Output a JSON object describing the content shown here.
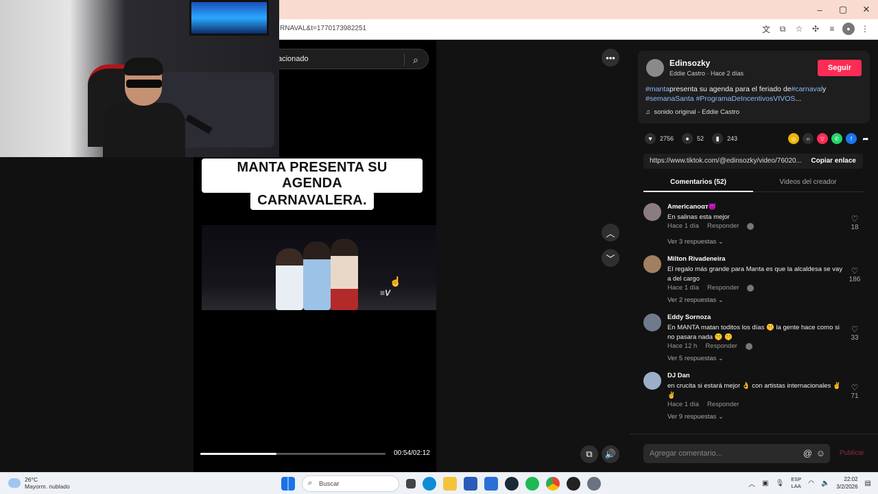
{
  "browser": {
    "url_fragment": "RNAVAL&t=1770173982251",
    "window_controls": [
      "–",
      "▢",
      "✕"
    ],
    "extension_icons": [
      "translate-icon",
      "cast-icon",
      "star-icon",
      "extensions-icon",
      "reading-list-icon",
      "profile-icon",
      "menu-icon"
    ]
  },
  "search": {
    "text": "acionado"
  },
  "video": {
    "caption_line1": "MANTA PRESENTA SU AGENDA",
    "caption_line2": "CARNAVALERA.",
    "watermark": "≡V",
    "progress": 0.41,
    "time": "00:54/02:12"
  },
  "author": {
    "name": "Edinsozky",
    "sub": "Eddie Castro · Hace 2 días",
    "follow_label": "Seguir",
    "desc_tag1": "#manta",
    "desc_text1": "presenta su agenda para el feriado de",
    "desc_tag2": "#carnaval",
    "desc_text2": "y",
    "desc_tag3": "#semanaSanta",
    "desc_tag4": "#ProgramaDeIncentivosVIVOS",
    "desc_ellipsis": "...",
    "sound": "sonido original - Eddie Castro"
  },
  "stats": {
    "likes": "2756",
    "comments": "52",
    "saves": "243"
  },
  "share": {
    "url": "https://www.tiktok.com/@edinsozky/video/76020...",
    "copy_label": "Copiar enlace"
  },
  "tabs": {
    "comments": "Comentarios (52)",
    "creator_videos": "Videos del creador"
  },
  "comments": [
    {
      "user": "Americanoαт😈",
      "text": "En salinas esta mejor",
      "time": "Hace 1 día",
      "reply": "Responder",
      "replies": "Ver 3 respuestas ⌄",
      "likes": "18",
      "avatar_color": "#8a7d80"
    },
    {
      "user": "Milton Rivadeneira",
      "text": "El regalo más grande para Manta es que la alcaldesa se vay a del cargo",
      "time": "Hace 1 día",
      "reply": "Responder",
      "replies": "Ver 2 respuestas ⌄",
      "likes": "186",
      "avatar_color": "#a08060"
    },
    {
      "user": "Eddy Sornoza",
      "text": "En MANTA matan toditos los días 🤫 la gente hace como si no pasara nada 🤫 🤫",
      "time": "Hace 12 h",
      "reply": "Responder",
      "replies": "Ver 5 respuestas ⌄",
      "likes": "33",
      "avatar_color": "#6f7a8c"
    },
    {
      "user": "DJ Dan",
      "text": "en crucita si estará mejor 👌 con artistas internacionales ✌ ✌",
      "time": "Hace 1 día",
      "reply": "Responder",
      "replies": "Ver 9 respuestas ⌄",
      "likes": "71",
      "avatar_color": "#9bb0c8"
    }
  ],
  "comment_input": {
    "placeholder": "Agregar comentario...",
    "publish": "Publicar"
  },
  "taskbar": {
    "temp": "26°C",
    "weather": "Mayorm. nublado",
    "search": "Buscar",
    "lang1": "ESP",
    "lang2": "LAA",
    "time": "22:02",
    "date": "3/2/2026"
  },
  "colors": {
    "accent": "#fe2c55",
    "hashtag": "#8fb8ff"
  }
}
